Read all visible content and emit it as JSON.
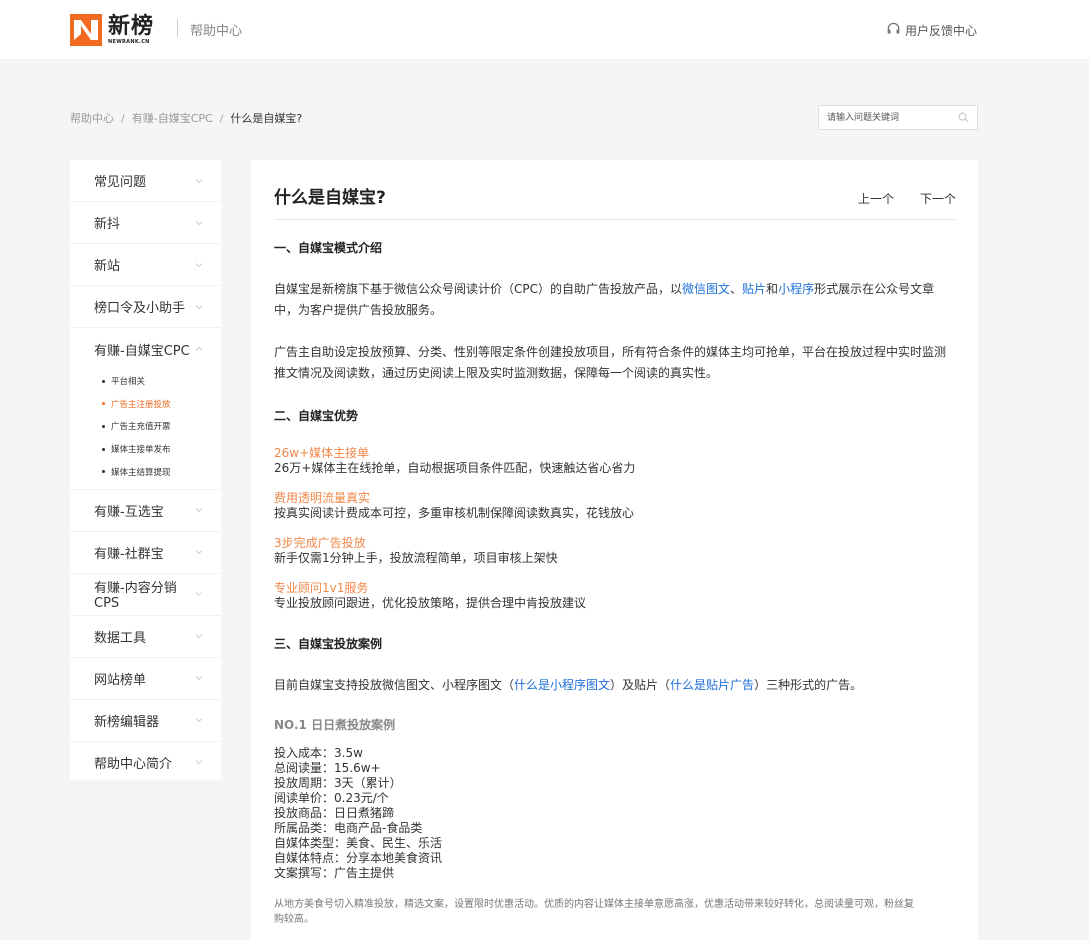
{
  "header": {
    "logo_cn": "新榜",
    "logo_en": "NEWRANK.CN",
    "title": "帮助中心",
    "feedback_label": "用户反馈中心",
    "colors": {
      "brand_orange": "#f06a22"
    }
  },
  "breadcrumb": {
    "items": [
      "帮助中心",
      "有赚-自媒宝CPC",
      "什么是自媒宝?"
    ],
    "separator": "/"
  },
  "search": {
    "placeholder": "请输入问题关键词",
    "value": ""
  },
  "sidebar": {
    "items": [
      {
        "label": "常见问题",
        "icon": "chevron-down-icon"
      },
      {
        "label": "新抖",
        "icon": "chevron-down-icon"
      },
      {
        "label": "新站",
        "icon": "chevron-down-icon"
      },
      {
        "label": "榜口令及小助手",
        "icon": "chevron-down-icon"
      },
      {
        "label": "有赚-自媒宝CPC",
        "icon": "chevron-up-icon",
        "expanded": true
      },
      {
        "label": "有赚-互选宝",
        "icon": "chevron-down-icon"
      },
      {
        "label": "有赚-社群宝",
        "icon": "chevron-down-icon"
      },
      {
        "label": "有赚-内容分销CPS",
        "icon": "chevron-down-icon"
      },
      {
        "label": "数据工具",
        "icon": "chevron-down-icon"
      },
      {
        "label": "网站榜单",
        "icon": "chevron-down-icon"
      },
      {
        "label": "新榜编辑器",
        "icon": "chevron-down-icon"
      },
      {
        "label": "帮助中心简介",
        "icon": "chevron-down-icon"
      }
    ],
    "sub_items": [
      {
        "label": "平台相关",
        "active": false
      },
      {
        "label": "广告主注册投放",
        "active": true
      },
      {
        "label": "广告主充值开票",
        "active": false
      },
      {
        "label": "媒体主接单发布",
        "active": false
      },
      {
        "label": "媒体主结算提现",
        "active": false
      }
    ]
  },
  "article": {
    "title": "什么是自媒宝?",
    "prev_label": "上一个",
    "next_label": "下一个",
    "s1_heading": "一、自媒宝模式介绍",
    "s1_p1_a": "自媒宝是新榜旗下基于微信公众号阅读计价（CPC）的自助广告投放产品，以",
    "s1_p1_link1": "微信图文",
    "s1_p1_sep1": "、",
    "s1_p1_link2": "贴片",
    "s1_p1_and": "和",
    "s1_p1_link3": "小程序",
    "s1_p1_b": "形式展示在公众号文章",
    "s1_p1_c": "中，为客户提供广告投放服务。",
    "s1_p2_a": "广告主自助设定投放预算、分类、性别等限定条件创建投放项目，所有符合条件的媒体主均可抢单，平台在投放过程中实时监测",
    "s1_p2_b": "推文情况及阅读数，通过历史阅读上限及实时监测数据，保障每一个阅读的真实性。",
    "s2_heading": "二、自媒宝优势",
    "advantages": [
      {
        "title": "26w+媒体主接单",
        "desc": "26万+媒体主在线抢单，自动根据项目条件匹配，快速触达省心省力"
      },
      {
        "title": "费用透明流量真实",
        "desc": "按真实阅读计费成本可控，多重审核机制保障阅读数真实，花钱放心"
      },
      {
        "title": "3步完成广告投放",
        "desc": "新手仅需1分钟上手，投放流程简单，项目审核上架快"
      },
      {
        "title": "专业顾问1v1服务",
        "desc": "专业投放顾问跟进，优化投放策略，提供合理中肯投放建议"
      }
    ],
    "s3_heading": "三、自媒宝投放案例",
    "s3_p_a": "目前自媒宝支持投放微信图文、小程序图文（",
    "s3_p_link1": "什么是小程序图文",
    "s3_p_b": "）及贴片（",
    "s3_p_link2": "什么是贴片广告",
    "s3_p_c": "）三种形式的广告。",
    "case_title": "NO.1 日日煮投放案例",
    "case_lines": [
      "投入成本：3.5w",
      "总阅读量：15.6w+",
      "投放周期：3天（累计）",
      "阅读单价：0.23元/个",
      "投放商品：日日煮猪蹄",
      "所属品类：电商产品-食品类",
      "自媒体类型：美食、民生、乐活",
      "自媒体特点：分享本地美食资讯",
      "文案撰写：广告主提供"
    ],
    "note_a": "从地方美食号切入精准投放，精选文案，设置限时优惠活动。优质的内容让媒体主接单意愿高涨，优惠活动带来较好转化，总阅读量可观，粉丝复",
    "note_b": "购较高。"
  }
}
